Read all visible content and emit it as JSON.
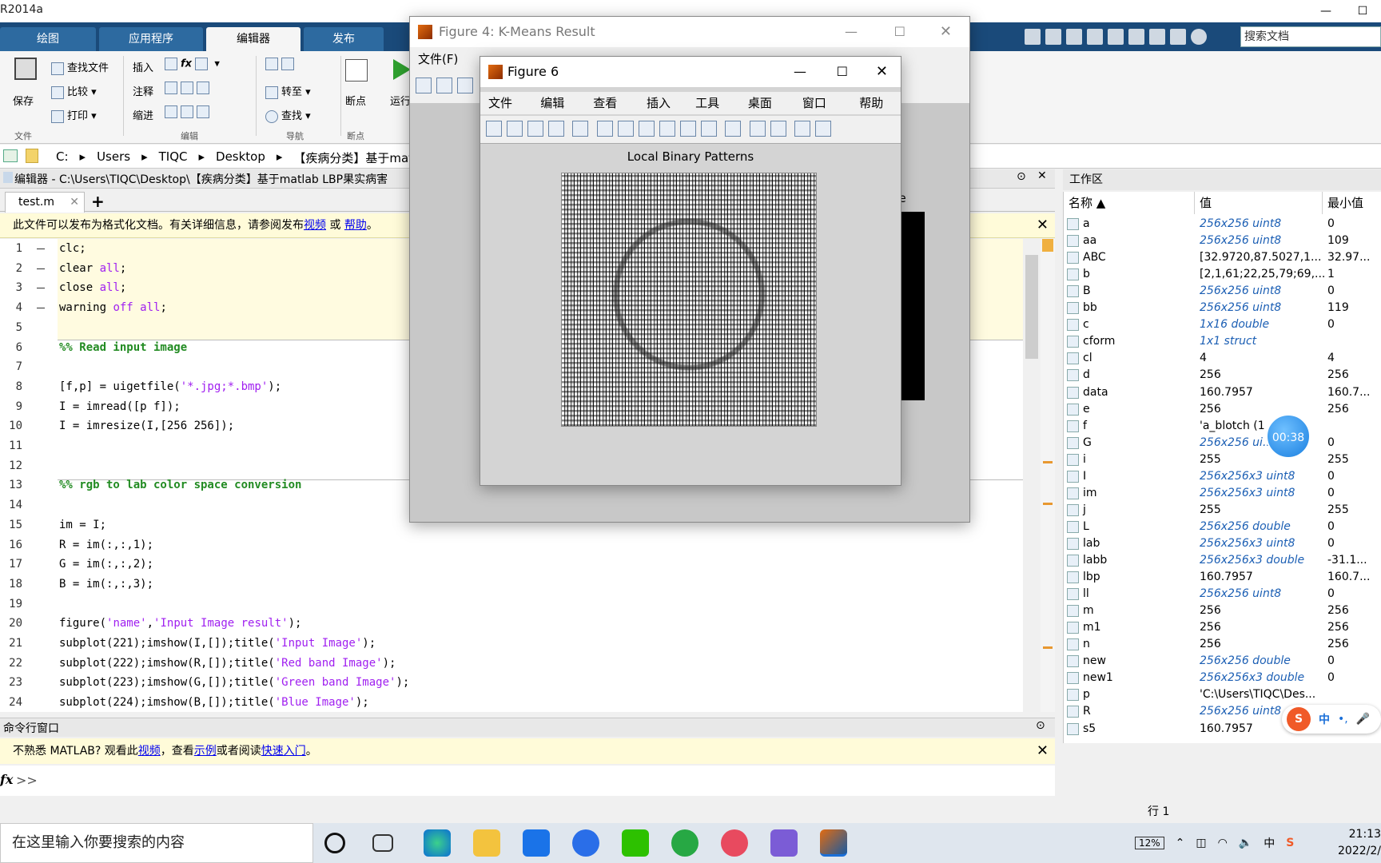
{
  "app": {
    "title": "R2014a"
  },
  "ribbon": {
    "tabs": [
      {
        "label": "绘图"
      },
      {
        "label": "应用程序"
      },
      {
        "label": "编辑器"
      },
      {
        "label": "发布"
      }
    ],
    "search_placeholder": "搜索文档",
    "file_group": {
      "save": "保存",
      "find_files": "查找文件",
      "compare": "比较",
      "print": "打印",
      "label": "文件"
    },
    "edit_group": {
      "insert": "插入",
      "comment": "注释",
      "indent": "缩进",
      "fx": "fx",
      "label": "编辑"
    },
    "nav_group": {
      "goto": "转至",
      "find": "查找",
      "label": "导航"
    },
    "bp_group": {
      "breakpoint": "断点",
      "label": "断点"
    },
    "run": {
      "label": "运行"
    }
  },
  "address": {
    "crumbs": [
      "C:",
      "Users",
      "TIQC",
      "Desktop",
      "【疾病分类】基于matlab"
    ]
  },
  "editor": {
    "header": "编辑器 - C:\\Users\\TIQC\\Desktop\\【疾病分类】基于matlab LBP果实病害",
    "file_tab": "test.m",
    "notice": {
      "text": "此文件可以发布为格式化文档。有关详细信息，请参阅发布",
      "link1": "视频",
      "mid": " 或 ",
      "link2": "帮助",
      "end": "。"
    },
    "lines": [
      {
        "n": "1",
        "code": "clc;"
      },
      {
        "n": "2",
        "code": "clear all;"
      },
      {
        "n": "3",
        "code": "close all;"
      },
      {
        "n": "4",
        "code": "warning off all;"
      },
      {
        "n": "5",
        "code": ""
      },
      {
        "n": "6",
        "code": "%% Read input image"
      },
      {
        "n": "7",
        "code": ""
      },
      {
        "n": "8",
        "code": "[f,p] = uigetfile('*.jpg;*.bmp');"
      },
      {
        "n": "9",
        "code": "I = imread([p f]);"
      },
      {
        "n": "10",
        "code": "I = imresize(I,[256 256]);"
      },
      {
        "n": "11",
        "code": ""
      },
      {
        "n": "12",
        "code": ""
      },
      {
        "n": "13",
        "code": "%% rgb to lab color space conversion"
      },
      {
        "n": "14",
        "code": ""
      },
      {
        "n": "15",
        "code": "im = I;"
      },
      {
        "n": "16",
        "code": "R = im(:,:,1);"
      },
      {
        "n": "17",
        "code": "G = im(:,:,2);"
      },
      {
        "n": "18",
        "code": "B = im(:,:,3);"
      },
      {
        "n": "19",
        "code": ""
      },
      {
        "n": "20",
        "code": "figure('name','Input Image result');"
      },
      {
        "n": "21",
        "code": "subplot(221);imshow(I,[]);title('Input Image');"
      },
      {
        "n": "22",
        "code": "subplot(222);imshow(R,[]);title('Red band Image');"
      },
      {
        "n": "23",
        "code": "subplot(223);imshow(G,[]);title('Green band Image');"
      },
      {
        "n": "24",
        "code": "subplot(224);imshow(B,[]);title('Blue Image');"
      }
    ]
  },
  "command": {
    "header": "命令行窗口",
    "notice": {
      "a": "不熟悉 MATLAB? 观看此",
      "l1": "视频",
      "b": "，查看",
      "l2": "示例",
      "c": "或者阅读",
      "l3": "快速入门",
      "d": "。"
    },
    "prompt": ">>",
    "fx": "fx"
  },
  "workspace": {
    "header": "工作区",
    "columns": [
      "名称 ▲",
      "值",
      "最小值"
    ],
    "rows": [
      {
        "name": "a",
        "value": "256x256 uint8",
        "min": "0",
        "italic": true
      },
      {
        "name": "aa",
        "value": "256x256 uint8",
        "min": "109",
        "italic": true
      },
      {
        "name": "ABC",
        "value": "[32.9720,87.5027,1...",
        "min": "32.97...",
        "italic": false
      },
      {
        "name": "b",
        "value": "[2,1,61;22,25,79;69,...",
        "min": "1",
        "italic": false
      },
      {
        "name": "B",
        "value": "256x256 uint8",
        "min": "0",
        "italic": true
      },
      {
        "name": "bb",
        "value": "256x256 uint8",
        "min": "119",
        "italic": true
      },
      {
        "name": "c",
        "value": "1x16 double",
        "min": "0",
        "italic": true
      },
      {
        "name": "cform",
        "value": "1x1 struct",
        "min": "",
        "italic": true
      },
      {
        "name": "cl",
        "value": "4",
        "min": "4",
        "italic": false
      },
      {
        "name": "d",
        "value": "256",
        "min": "256",
        "italic": false
      },
      {
        "name": "data",
        "value": "160.7957",
        "min": "160.7...",
        "italic": false
      },
      {
        "name": "e",
        "value": "256",
        "min": "256",
        "italic": false
      },
      {
        "name": "f",
        "value": "'a_blotch (1",
        "min": "",
        "italic": false
      },
      {
        "name": "G",
        "value": "256x256 ui...",
        "min": "0",
        "italic": true
      },
      {
        "name": "i",
        "value": "255",
        "min": "255",
        "italic": false
      },
      {
        "name": "I",
        "value": "256x256x3 uint8",
        "min": "0",
        "italic": true
      },
      {
        "name": "im",
        "value": "256x256x3 uint8",
        "min": "0",
        "italic": true
      },
      {
        "name": "j",
        "value": "255",
        "min": "255",
        "italic": false
      },
      {
        "name": "L",
        "value": "256x256 double",
        "min": "0",
        "italic": true
      },
      {
        "name": "lab",
        "value": "256x256x3 uint8",
        "min": "0",
        "italic": true
      },
      {
        "name": "labb",
        "value": "256x256x3 double",
        "min": "-31.1...",
        "italic": true
      },
      {
        "name": "lbp",
        "value": "160.7957",
        "min": "160.7...",
        "italic": false
      },
      {
        "name": "ll",
        "value": "256x256 uint8",
        "min": "0",
        "italic": true
      },
      {
        "name": "m",
        "value": "256",
        "min": "256",
        "italic": false
      },
      {
        "name": "m1",
        "value": "256",
        "min": "256",
        "italic": false
      },
      {
        "name": "n",
        "value": "256",
        "min": "256",
        "italic": false
      },
      {
        "name": "new",
        "value": "256x256 double",
        "min": "0",
        "italic": true
      },
      {
        "name": "new1",
        "value": "256x256x3 double",
        "min": "0",
        "italic": true
      },
      {
        "name": "p",
        "value": "'C:\\Users\\TIQC\\Des...",
        "min": "",
        "italic": false
      },
      {
        "name": "R",
        "value": "256x256 uint8",
        "min": "",
        "italic": true
      },
      {
        "name": "s5",
        "value": "160.7957",
        "min": "160.7...",
        "italic": false
      }
    ],
    "status": "行 1"
  },
  "timer": "00:38",
  "fig4": {
    "title": "Figure 4: K-Means Result",
    "menu": [
      "文件(F)"
    ],
    "partial_label": "ge"
  },
  "fig6": {
    "title": "Figure 6",
    "menu": [
      "文件(F)",
      "编辑(E)",
      "查看(V)",
      "插入(I)",
      "工具(T)",
      "桌面(D)",
      "窗口(W)",
      "帮助(H)"
    ],
    "plot_title": "Local Binary Patterns"
  },
  "taskbar": {
    "search": "在这里输入你要搜索的内容",
    "battery": "12%",
    "ime": "中",
    "time": "21:13",
    "date": "2022/2/"
  },
  "ime_bar": {
    "label": "中"
  }
}
